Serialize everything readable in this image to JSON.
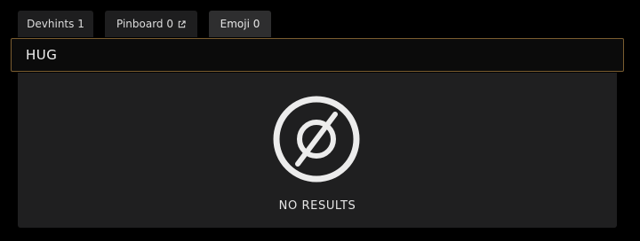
{
  "tabs": [
    {
      "label": "Devhints 1",
      "active": false,
      "external": false
    },
    {
      "label": "Pinboard 0",
      "active": false,
      "external": true
    },
    {
      "label": "Emoji 0",
      "active": true,
      "external": false
    }
  ],
  "search": {
    "value": "HUG",
    "placeholder": ""
  },
  "results": {
    "icon": "no-results-icon",
    "message": "NO RESULTS"
  },
  "colors": {
    "background": "#000000",
    "tab": "#1e1e1f",
    "tab_active": "#2e2e2f",
    "input_border": "#7a5d30",
    "panel": "#1f1f20",
    "text": "#e6e6e6"
  }
}
